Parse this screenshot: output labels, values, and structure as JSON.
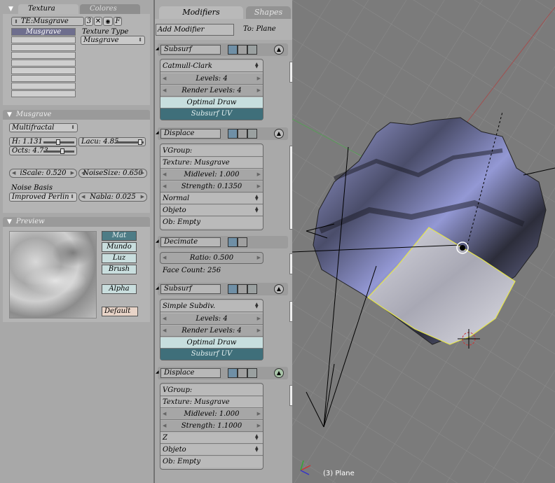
{
  "texture_panel": {
    "tabs": [
      "Textura",
      "Colores"
    ],
    "te_name": "TE:Musgrave",
    "te_users": "3",
    "te_f": "F",
    "texture_type_label": "Texture Type",
    "texture_type_value": "Musgrave",
    "list_selected": "Musgrave"
  },
  "musgrave_panel": {
    "title": "Musgrave",
    "type_value": "Multifractal",
    "h": "H: 1.131",
    "lacu": "Lacu: 4.85",
    "octs": "Octs: 4.73",
    "iscale": "iScale: 0.520",
    "noisesize": "NoiseSize: 0.650",
    "noise_basis_label": "Noise Basis",
    "noise_basis_value": "Improved Perlin",
    "nabla": "Nabla: 0.025"
  },
  "preview_panel": {
    "title": "Preview",
    "buttons": [
      "Mat",
      "Mundo",
      "Luz",
      "Brush"
    ],
    "alpha": "Alpha",
    "default": "Default Va"
  },
  "modifiers_panel": {
    "tabs": [
      "Modifiers",
      "Shapes"
    ],
    "add_modifier": "Add Modifier",
    "to_label": "To: Plane",
    "mod1": {
      "name": "Subsurf",
      "type": "Catmull-Clark",
      "levels": "Levels: 4",
      "render_levels": "Render Levels: 4",
      "optimal_draw": "Optimal Draw",
      "subsurf_uv": "Subsurf UV"
    },
    "mod2": {
      "name": "Displace",
      "vgroup": "VGroup:",
      "texture": "Texture: Musgrave",
      "midlevel": "Midlevel: 1.000",
      "strength": "Strength: 0.1350",
      "direction": "Normal",
      "texcoord": "Objeto",
      "ob": "Ob: Empty"
    },
    "mod3": {
      "name": "Decimate",
      "ratio": "Ratio: 0.500",
      "face_count": "Face Count: 256"
    },
    "mod4": {
      "name": "Subsurf",
      "type": "Simple Subdiv.",
      "levels": "Levels: 4",
      "render_levels": "Render Levels: 4",
      "optimal_draw": "Optimal Draw",
      "subsurf_uv": "Subsurf UV"
    },
    "mod5": {
      "name": "Displace",
      "vgroup": "VGroup:",
      "texture": "Texture: Musgrave",
      "midlevel": "Midlevel: 1.000",
      "strength": "Strength: 1.1000",
      "direction": "Z",
      "texcoord": "Objeto",
      "ob": "Ob: Empty"
    }
  },
  "viewport": {
    "object_label": "(3) Plane"
  },
  "colors": {
    "panel_bg": "#a8a8a8",
    "viewport_bg": "#7b7b7b",
    "accent_button": "#3f6f7a",
    "mesh_blue": "#8a8fd0"
  }
}
